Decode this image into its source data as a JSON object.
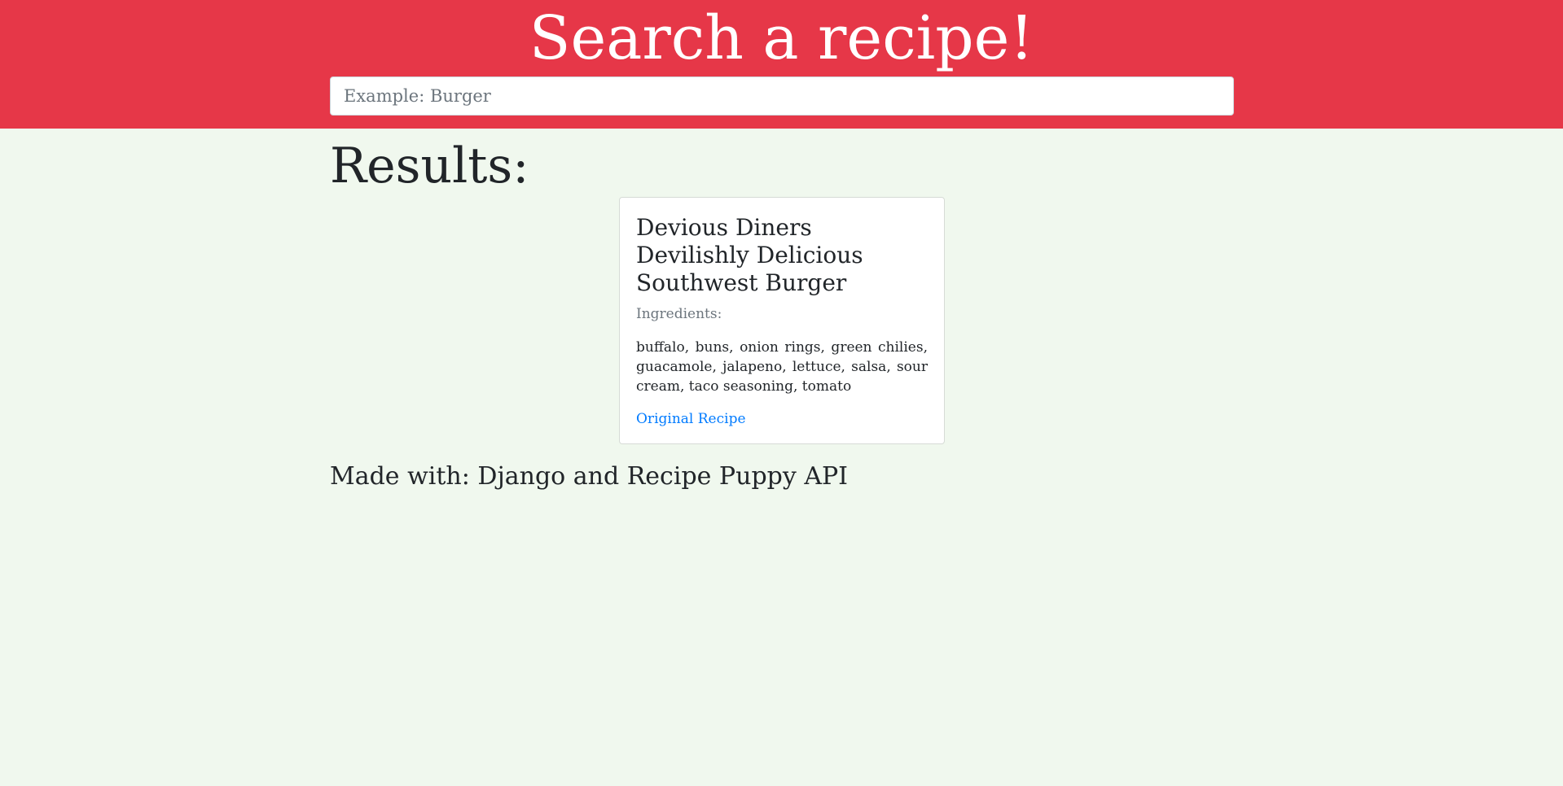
{
  "header": {
    "title": "Search a recipe!",
    "background_color": "#e63748"
  },
  "search": {
    "placeholder": "Example: Burger",
    "value": ""
  },
  "results": {
    "heading": "Results:",
    "items": [
      {
        "title": "Devious Diners Devilishly Delicious Southwest Burger",
        "ingredients_label": "Ingredients:",
        "ingredients": "buffalo, buns, onion rings, green chilies, guacamole, jalapeno, lettuce, salsa, sour cream, taco seasoning, tomato",
        "link_label": "Original Recipe",
        "link_color": "#007bff"
      }
    ]
  },
  "footer": {
    "text": "Made with: Django and Recipe Puppy API"
  },
  "page": {
    "background_color": "#f0f8ee"
  }
}
